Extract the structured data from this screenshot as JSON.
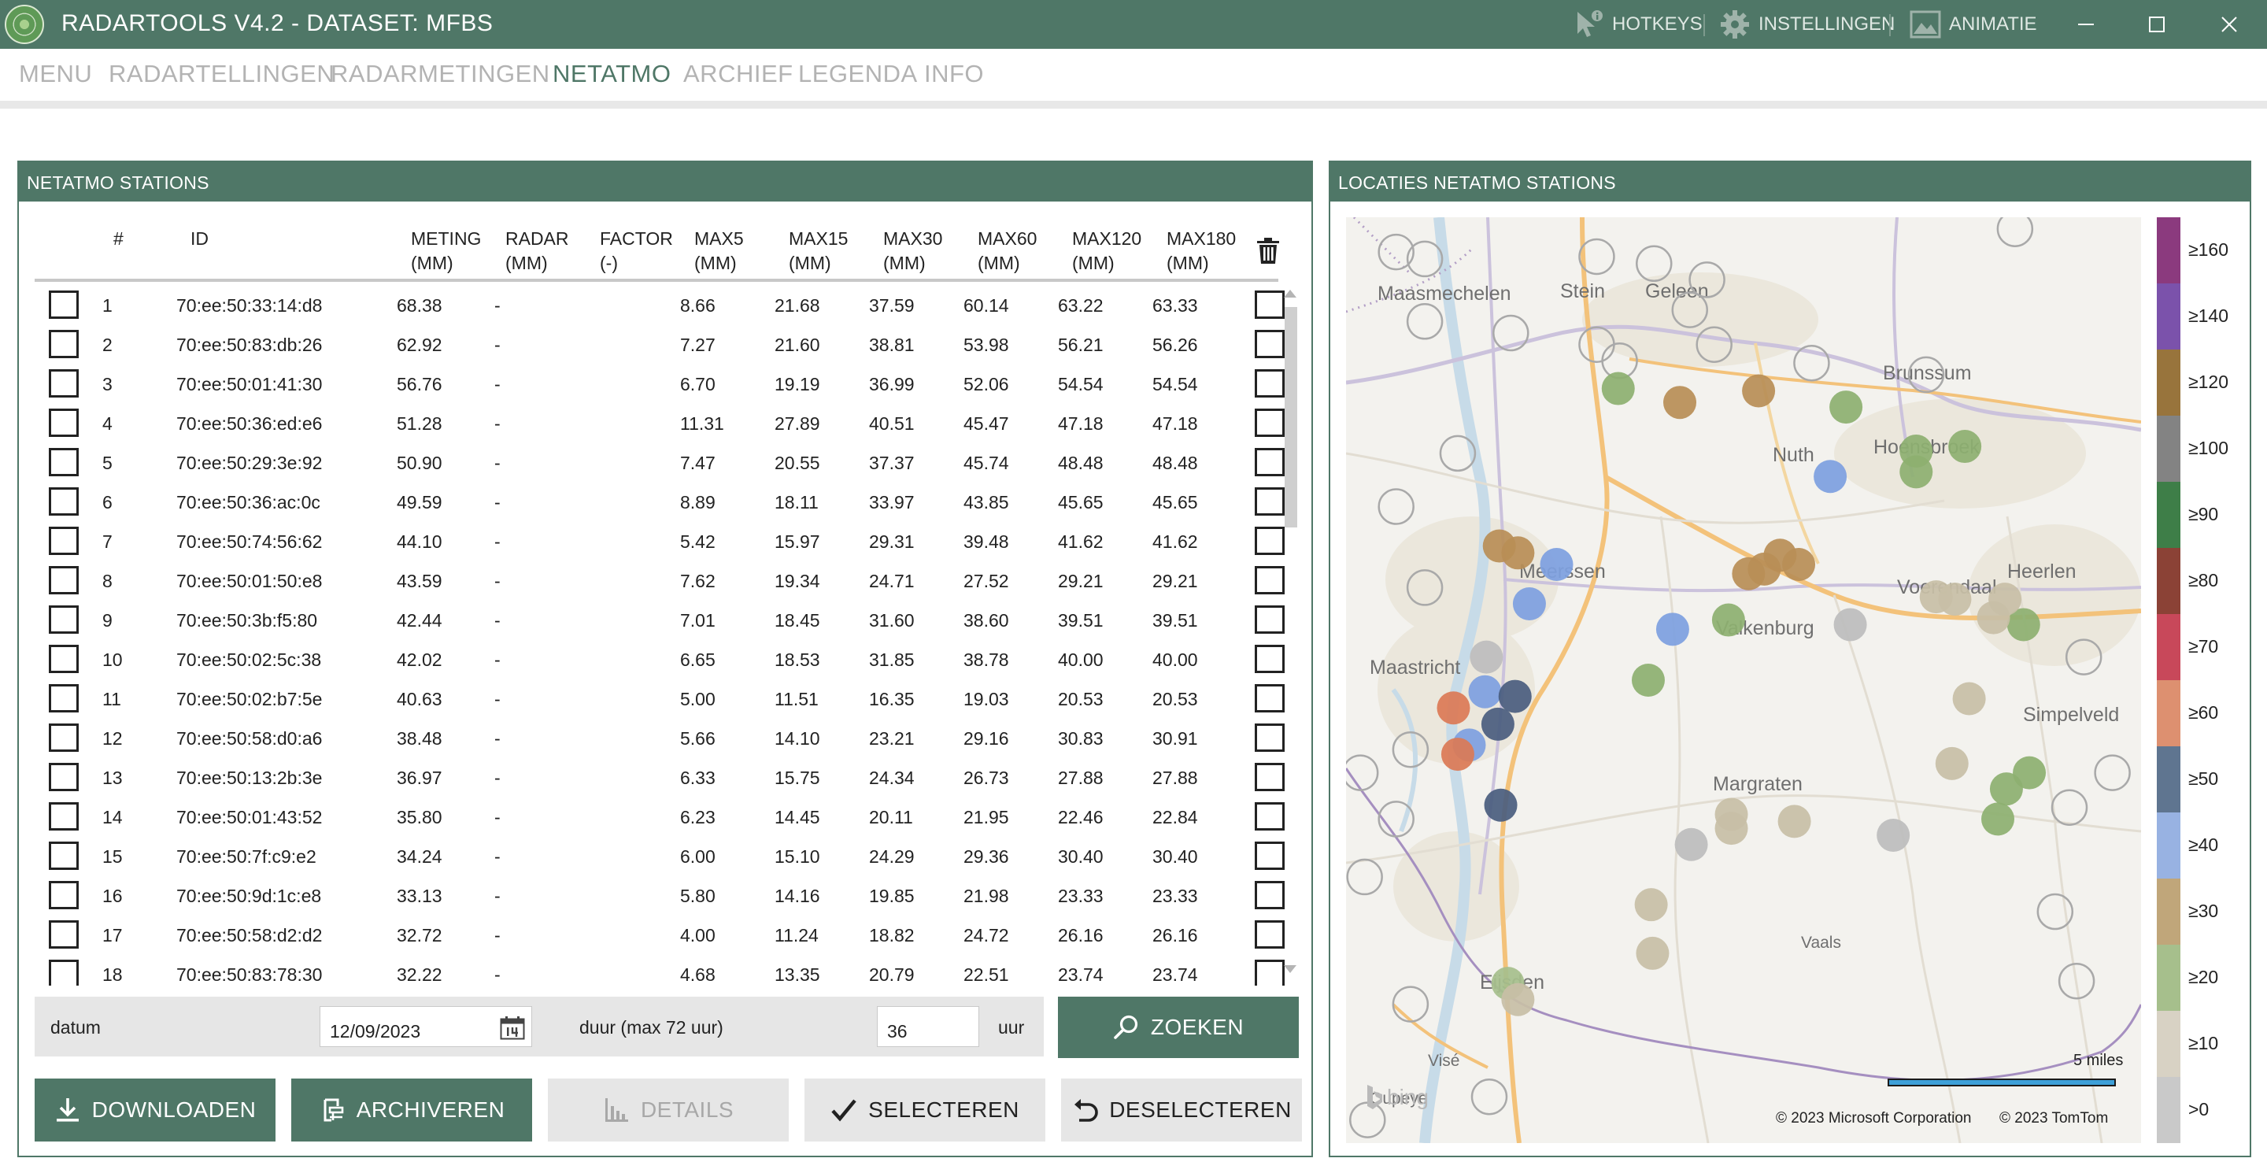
{
  "titlebar": {
    "title": "RADARTOOLS V4.2 - DATASET: MFBS",
    "hotkeys_label": "HOTKEYS",
    "settings_label": "INSTELLINGEN",
    "animation_label": "ANIMATIE"
  },
  "menu": {
    "items": [
      {
        "label": "MENU"
      },
      {
        "label": "RADARTELLINGEN"
      },
      {
        "label": "RADARMETINGEN"
      },
      {
        "label": "NETATMO"
      },
      {
        "label": "ARCHIEF"
      },
      {
        "label": "LEGENDA"
      },
      {
        "label": "INFO"
      }
    ],
    "active": "NETATMO"
  },
  "stations_panel": {
    "title": "NETATMO STATIONS",
    "headers": {
      "num": "#",
      "id": "ID",
      "meting": "METING\n(MM)",
      "radar": "RADAR\n(MM)",
      "factor": "FACTOR\n(-)",
      "max5": "MAX5\n(MM)",
      "max15": "MAX15\n(MM)",
      "max30": "MAX30\n(MM)",
      "max60": "MAX60\n(MM)",
      "max120": "MAX120\n(MM)",
      "max180": "MAX180\n(MM)"
    },
    "rows": [
      {
        "n": "1",
        "id": "70:ee:50:33:14:d8",
        "meting": "68.38",
        "radar": "-",
        "factor": "",
        "max5": "8.66",
        "max15": "21.68",
        "max30": "37.59",
        "max60": "60.14",
        "max120": "63.22",
        "max180": "63.33"
      },
      {
        "n": "2",
        "id": "70:ee:50:83:db:26",
        "meting": "62.92",
        "radar": "-",
        "factor": "",
        "max5": "7.27",
        "max15": "21.60",
        "max30": "38.81",
        "max60": "53.98",
        "max120": "56.21",
        "max180": "56.26"
      },
      {
        "n": "3",
        "id": "70:ee:50:01:41:30",
        "meting": "56.76",
        "radar": "-",
        "factor": "",
        "max5": "6.70",
        "max15": "19.19",
        "max30": "36.99",
        "max60": "52.06",
        "max120": "54.54",
        "max180": "54.54"
      },
      {
        "n": "4",
        "id": "70:ee:50:36:ed:e6",
        "meting": "51.28",
        "radar": "-",
        "factor": "",
        "max5": "11.31",
        "max15": "27.89",
        "max30": "40.51",
        "max60": "45.47",
        "max120": "47.18",
        "max180": "47.18"
      },
      {
        "n": "5",
        "id": "70:ee:50:29:3e:92",
        "meting": "50.90",
        "radar": "-",
        "factor": "",
        "max5": "7.47",
        "max15": "20.55",
        "max30": "37.37",
        "max60": "45.74",
        "max120": "48.48",
        "max180": "48.48"
      },
      {
        "n": "6",
        "id": "70:ee:50:36:ac:0c",
        "meting": "49.59",
        "radar": "-",
        "factor": "",
        "max5": "8.89",
        "max15": "18.11",
        "max30": "33.97",
        "max60": "43.85",
        "max120": "45.65",
        "max180": "45.65"
      },
      {
        "n": "7",
        "id": "70:ee:50:74:56:62",
        "meting": "44.10",
        "radar": "-",
        "factor": "",
        "max5": "5.42",
        "max15": "15.97",
        "max30": "29.31",
        "max60": "39.48",
        "max120": "41.62",
        "max180": "41.62"
      },
      {
        "n": "8",
        "id": "70:ee:50:01:50:e8",
        "meting": "43.59",
        "radar": "-",
        "factor": "",
        "max5": "7.62",
        "max15": "19.34",
        "max30": "24.71",
        "max60": "27.52",
        "max120": "29.21",
        "max180": "29.21"
      },
      {
        "n": "9",
        "id": "70:ee:50:3b:f5:80",
        "meting": "42.44",
        "radar": "-",
        "factor": "",
        "max5": "7.01",
        "max15": "18.45",
        "max30": "31.60",
        "max60": "38.60",
        "max120": "39.51",
        "max180": "39.51"
      },
      {
        "n": "10",
        "id": "70:ee:50:02:5c:38",
        "meting": "42.02",
        "radar": "-",
        "factor": "",
        "max5": "6.65",
        "max15": "18.53",
        "max30": "31.85",
        "max60": "38.78",
        "max120": "40.00",
        "max180": "40.00"
      },
      {
        "n": "11",
        "id": "70:ee:50:02:b7:5e",
        "meting": "40.63",
        "radar": "-",
        "factor": "",
        "max5": "5.00",
        "max15": "11.51",
        "max30": "16.35",
        "max60": "19.03",
        "max120": "20.53",
        "max180": "20.53"
      },
      {
        "n": "12",
        "id": "70:ee:50:58:d0:a6",
        "meting": "38.48",
        "radar": "-",
        "factor": "",
        "max5": "5.66",
        "max15": "14.10",
        "max30": "23.21",
        "max60": "29.16",
        "max120": "30.83",
        "max180": "30.91"
      },
      {
        "n": "13",
        "id": "70:ee:50:13:2b:3e",
        "meting": "36.97",
        "radar": "-",
        "factor": "",
        "max5": "6.33",
        "max15": "15.75",
        "max30": "24.34",
        "max60": "26.73",
        "max120": "27.88",
        "max180": "27.88"
      },
      {
        "n": "14",
        "id": "70:ee:50:01:43:52",
        "meting": "35.80",
        "radar": "-",
        "factor": "",
        "max5": "6.23",
        "max15": "14.45",
        "max30": "20.11",
        "max60": "21.95",
        "max120": "22.46",
        "max180": "22.84"
      },
      {
        "n": "15",
        "id": "70:ee:50:7f:c9:e2",
        "meting": "34.24",
        "radar": "-",
        "factor": "",
        "max5": "6.00",
        "max15": "15.10",
        "max30": "24.29",
        "max60": "29.36",
        "max120": "30.40",
        "max180": "30.40"
      },
      {
        "n": "16",
        "id": "70:ee:50:9d:1c:e8",
        "meting": "33.13",
        "radar": "-",
        "factor": "",
        "max5": "5.80",
        "max15": "14.16",
        "max30": "19.85",
        "max60": "21.98",
        "max120": "23.33",
        "max180": "23.33"
      },
      {
        "n": "17",
        "id": "70:ee:50:58:d2:d2",
        "meting": "32.72",
        "radar": "-",
        "factor": "",
        "max5": "4.00",
        "max15": "11.24",
        "max30": "18.82",
        "max60": "24.72",
        "max120": "26.16",
        "max180": "26.16"
      },
      {
        "n": "18",
        "id": "70:ee:50:83:78:30",
        "meting": "32.22",
        "radar": "-",
        "factor": "",
        "max5": "4.68",
        "max15": "13.35",
        "max30": "20.79",
        "max60": "22.51",
        "max120": "23.74",
        "max180": "23.74"
      }
    ],
    "search": {
      "date_label": "datum",
      "date_value": "12/09/2023",
      "duration_label": "duur (max 72 uur)",
      "duration_value": "36",
      "duration_unit": "uur",
      "search_button": "ZOEKEN"
    },
    "buttons": {
      "download": "DOWNLOADEN",
      "archive": "ARCHIVEREN",
      "details": "DETAILS",
      "select": "SELECTEREN",
      "deselect": "DESELECTEREN"
    }
  },
  "map_panel": {
    "title": "LOCATIES NETATMO STATIONS",
    "places": [
      {
        "name": "Maasmechelen"
      },
      {
        "name": "Stein"
      },
      {
        "name": "Geleen"
      },
      {
        "name": "Brunssum"
      },
      {
        "name": "Nuth"
      },
      {
        "name": "Hoensbroek"
      },
      {
        "name": "Meerssen"
      },
      {
        "name": "Voerendaal"
      },
      {
        "name": "Heerlen"
      },
      {
        "name": "Valkenburg"
      },
      {
        "name": "Maastricht"
      },
      {
        "name": "Simpelveld"
      },
      {
        "name": "Margraten"
      },
      {
        "name": "Eijsden"
      },
      {
        "name": "Vaals"
      },
      {
        "name": "Visé"
      },
      {
        "name": "Oupeye"
      }
    ],
    "scale_label": "5 miles",
    "copyright_ms": "© 2023 Microsoft Corporation",
    "copyright_tomtom": "© 2023 TomTom",
    "bing_label": "bing",
    "legend": [
      {
        "label": "≥160",
        "color": "#8b3a7e"
      },
      {
        "label": "≥140",
        "color": "#7b52ab"
      },
      {
        "label": "≥120",
        "color": "#98743c"
      },
      {
        "label": "≥100",
        "color": "#838383"
      },
      {
        "label": "≥90",
        "color": "#3e7e48"
      },
      {
        "label": "≥80",
        "color": "#8b4236"
      },
      {
        "label": "≥70",
        "color": "#c8485a"
      },
      {
        "label": "≥60",
        "color": "#dd9070"
      },
      {
        "label": "≥50",
        "color": "#5f7590"
      },
      {
        "label": "≥40",
        "color": "#98b2e2"
      },
      {
        "label": "≥30",
        "color": "#c0a67a"
      },
      {
        "label": "≥20",
        "color": "#a6bf8c"
      },
      {
        "label": "≥10",
        "color": "#d8d2c4"
      },
      {
        "label": ">0",
        "color": "#c9c9c9"
      }
    ],
    "stations": [
      {
        "lon": 5.795,
        "lat": 50.956,
        "color": "#8db070"
      },
      {
        "lon": 5.838,
        "lat": 50.95,
        "color": "#b88e56"
      },
      {
        "lon": 5.893,
        "lat": 50.955,
        "color": "#b88e56"
      },
      {
        "lon": 5.954,
        "lat": 50.948,
        "color": "#8db070"
      },
      {
        "lon": 6.037,
        "lat": 50.931,
        "color": "#8db070"
      },
      {
        "lon": 6.003,
        "lat": 50.92,
        "color": "#8db070"
      },
      {
        "lon": 6.003,
        "lat": 50.929,
        "color": "#8db070"
      },
      {
        "lon": 5.943,
        "lat": 50.918,
        "color": "#7d9fe0"
      },
      {
        "lon": 5.712,
        "lat": 50.888,
        "color": "#b88e56"
      },
      {
        "lon": 5.725,
        "lat": 50.885,
        "color": "#b88e56"
      },
      {
        "lon": 5.752,
        "lat": 50.88,
        "color": "#7d9fe0"
      },
      {
        "lon": 5.733,
        "lat": 50.863,
        "color": "#7d9fe0"
      },
      {
        "lon": 5.886,
        "lat": 50.876,
        "color": "#b88e56"
      },
      {
        "lon": 5.897,
        "lat": 50.878,
        "color": "#b88e56"
      },
      {
        "lon": 5.908,
        "lat": 50.884,
        "color": "#b88e56"
      },
      {
        "lon": 5.921,
        "lat": 50.88,
        "color": "#b88e56"
      },
      {
        "lon": 5.872,
        "lat": 50.856,
        "color": "#8db070"
      },
      {
        "lon": 5.833,
        "lat": 50.852,
        "color": "#7d9fe0"
      },
      {
        "lon": 5.957,
        "lat": 50.854,
        "color": "#bdbdbd"
      },
      {
        "lon": 5.816,
        "lat": 50.83,
        "color": "#8db070"
      },
      {
        "lon": 6.017,
        "lat": 50.866,
        "color": "#c8bfa6"
      },
      {
        "lon": 6.03,
        "lat": 50.865,
        "color": "#c8bfa6"
      },
      {
        "lon": 6.078,
        "lat": 50.854,
        "color": "#8db070"
      },
      {
        "lon": 6.057,
        "lat": 50.857,
        "color": "#c8bfa6"
      },
      {
        "lon": 6.065,
        "lat": 50.865,
        "color": "#c8bfa6"
      },
      {
        "lon": 5.703,
        "lat": 50.84,
        "color": "#bdbdbd"
      },
      {
        "lon": 5.702,
        "lat": 50.825,
        "color": "#7d9fe0"
      },
      {
        "lon": 5.723,
        "lat": 50.823,
        "color": "#4a5d7e"
      },
      {
        "lon": 5.711,
        "lat": 50.811,
        "color": "#4a5d7e"
      },
      {
        "lon": 5.68,
        "lat": 50.818,
        "color": "#db7a55"
      },
      {
        "lon": 5.691,
        "lat": 50.802,
        "color": "#7d9fe0"
      },
      {
        "lon": 5.683,
        "lat": 50.798,
        "color": "#db7a55"
      },
      {
        "lon": 5.713,
        "lat": 50.776,
        "color": "#4a5d7e"
      },
      {
        "lon": 6.04,
        "lat": 50.822,
        "color": "#c8bfa6"
      },
      {
        "lon": 6.028,
        "lat": 50.794,
        "color": "#c8bfa6"
      },
      {
        "lon": 6.082,
        "lat": 50.79,
        "color": "#8db070"
      },
      {
        "lon": 6.066,
        "lat": 50.783,
        "color": "#8db070"
      },
      {
        "lon": 6.06,
        "lat": 50.77,
        "color": "#8db070"
      },
      {
        "lon": 5.846,
        "lat": 50.759,
        "color": "#bdbdbd"
      },
      {
        "lon": 5.874,
        "lat": 50.766,
        "color": "#c8bfa6"
      },
      {
        "lon": 5.874,
        "lat": 50.772,
        "color": "#c8bfa6"
      },
      {
        "lon": 5.918,
        "lat": 50.769,
        "color": "#c8bfa6"
      },
      {
        "lon": 5.987,
        "lat": 50.763,
        "color": "#bdbdbd"
      },
      {
        "lon": 5.818,
        "lat": 50.733,
        "color": "#c8bfa6"
      },
      {
        "lon": 5.819,
        "lat": 50.712,
        "color": "#c8bfa6"
      },
      {
        "lon": 5.718,
        "lat": 50.699,
        "color": "#a6bf8c"
      },
      {
        "lon": 5.725,
        "lat": 50.692,
        "color": "#c8bfa6"
      }
    ],
    "inactive_stations": [
      {
        "lon": 5.64,
        "lat": 51.015
      },
      {
        "lon": 5.66,
        "lat": 51.012
      },
      {
        "lon": 5.78,
        "lat": 51.013
      },
      {
        "lon": 5.66,
        "lat": 50.985
      },
      {
        "lon": 5.72,
        "lat": 50.98
      },
      {
        "lon": 5.82,
        "lat": 51.01
      },
      {
        "lon": 5.857,
        "lat": 51.003
      },
      {
        "lon": 5.845,
        "lat": 50.99
      },
      {
        "lon": 5.862,
        "lat": 50.975
      },
      {
        "lon": 5.78,
        "lat": 50.975
      },
      {
        "lon": 5.796,
        "lat": 50.968
      },
      {
        "lon": 5.93,
        "lat": 50.967
      },
      {
        "lon": 6.01,
        "lat": 50.962
      },
      {
        "lon": 6.072,
        "lat": 51.025
      },
      {
        "lon": 5.683,
        "lat": 50.928
      },
      {
        "lon": 5.64,
        "lat": 50.905
      },
      {
        "lon": 5.66,
        "lat": 50.87
      },
      {
        "lon": 5.65,
        "lat": 50.8
      },
      {
        "lon": 5.615,
        "lat": 50.79
      },
      {
        "lon": 5.64,
        "lat": 50.77
      },
      {
        "lon": 5.618,
        "lat": 50.745
      },
      {
        "lon": 6.12,
        "lat": 50.84
      },
      {
        "lon": 6.11,
        "lat": 50.775
      },
      {
        "lon": 6.14,
        "lat": 50.79
      },
      {
        "lon": 6.1,
        "lat": 50.73
      },
      {
        "lon": 6.115,
        "lat": 50.7
      },
      {
        "lon": 5.65,
        "lat": 50.69
      },
      {
        "lon": 5.705,
        "lat": 50.65
      },
      {
        "lon": 5.62,
        "lat": 50.64
      }
    ]
  }
}
